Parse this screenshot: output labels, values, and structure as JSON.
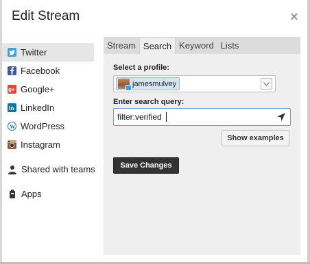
{
  "dialog": {
    "title": "Edit Stream",
    "close_glyph": "×"
  },
  "sidebar": {
    "items": [
      {
        "label": "Twitter",
        "icon": "twitter-icon",
        "active": true
      },
      {
        "label": "Facebook",
        "icon": "facebook-icon"
      },
      {
        "label": "Google+",
        "icon": "google-plus-icon"
      },
      {
        "label": "LinkedIn",
        "icon": "linkedin-icon"
      },
      {
        "label": "WordPress",
        "icon": "wordpress-icon"
      },
      {
        "label": "Instagram",
        "icon": "instagram-icon"
      },
      {
        "label": "Shared with teams",
        "icon": "team-icon"
      },
      {
        "label": "Apps",
        "icon": "apps-icon"
      }
    ]
  },
  "tabs": [
    {
      "label": "Stream"
    },
    {
      "label": "Search",
      "active": true
    },
    {
      "label": "Keyword"
    },
    {
      "label": "Lists"
    }
  ],
  "form": {
    "profile_label": "Select a profile:",
    "profile_value": "jamesmulvey",
    "query_label": "Enter search query:",
    "query_value": "filter:verified",
    "show_examples_label": "Show examples",
    "save_label": "Save Changes"
  },
  "colors": {
    "twitter": "#3aa1e3",
    "facebook": "#3b5998",
    "google_plus": "#dd4b39",
    "linkedin": "#0e76a8",
    "wordpress": "#21759b",
    "active_nav_bg": "#e6e6e6",
    "save_button_bg": "#333333"
  }
}
